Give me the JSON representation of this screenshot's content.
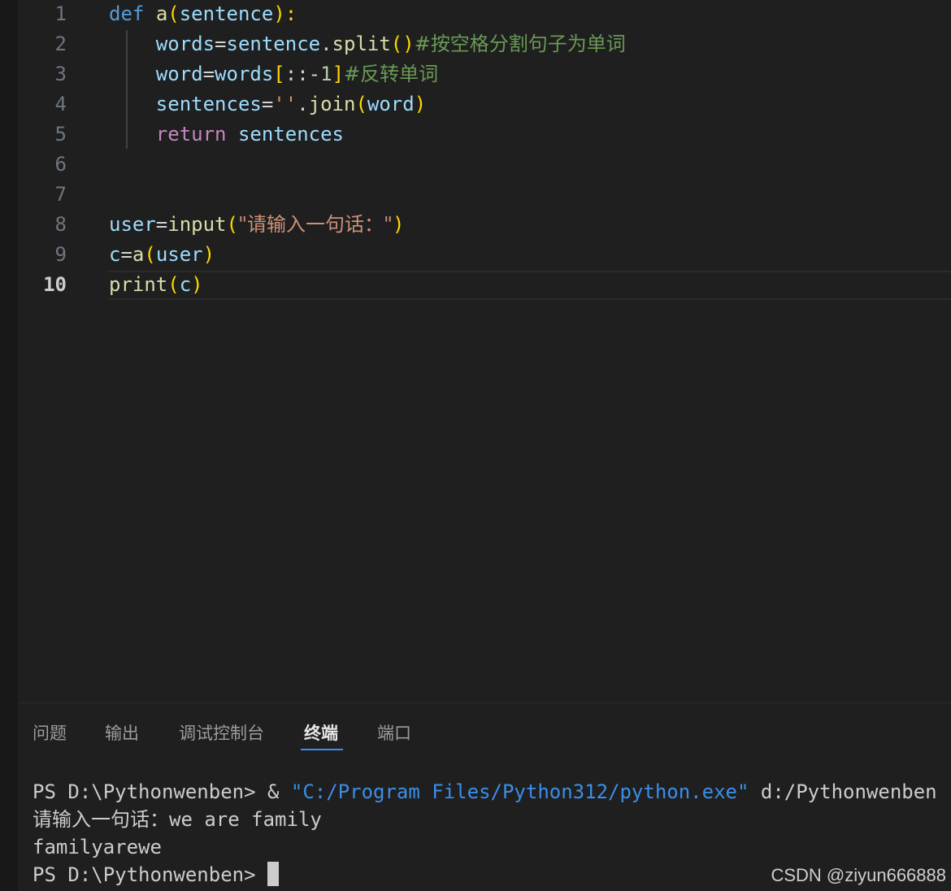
{
  "editor": {
    "active_line": "10",
    "lines": [
      {
        "num": "1",
        "parts": [
          {
            "t": "def",
            "c": "kw-def"
          },
          {
            "t": " ",
            "c": "op"
          },
          {
            "t": "a",
            "c": "fn"
          },
          {
            "t": "(",
            "c": "p1"
          },
          {
            "t": "sentence",
            "c": "var"
          },
          {
            "t": "):",
            "c": "p1"
          }
        ]
      },
      {
        "num": "2",
        "parts": [
          {
            "t": "    words",
            "c": "var"
          },
          {
            "t": "=",
            "c": "op"
          },
          {
            "t": "sentence",
            "c": "var"
          },
          {
            "t": ".",
            "c": "op"
          },
          {
            "t": "split",
            "c": "fn"
          },
          {
            "t": "()",
            "c": "p1"
          },
          {
            "t": "#按空格分割句子为单词",
            "c": "cmt"
          }
        ]
      },
      {
        "num": "3",
        "parts": [
          {
            "t": "    word",
            "c": "var"
          },
          {
            "t": "=",
            "c": "op"
          },
          {
            "t": "words",
            "c": "var"
          },
          {
            "t": "[",
            "c": "p1"
          },
          {
            "t": "::-",
            "c": "op"
          },
          {
            "t": "1",
            "c": "num"
          },
          {
            "t": "]",
            "c": "p1"
          },
          {
            "t": "#反转单词",
            "c": "cmt"
          }
        ]
      },
      {
        "num": "4",
        "parts": [
          {
            "t": "    sentences",
            "c": "var"
          },
          {
            "t": "=",
            "c": "op"
          },
          {
            "t": "''",
            "c": "str"
          },
          {
            "t": ".",
            "c": "op"
          },
          {
            "t": "join",
            "c": "fn"
          },
          {
            "t": "(",
            "c": "p1"
          },
          {
            "t": "word",
            "c": "var"
          },
          {
            "t": ")",
            "c": "p1"
          }
        ]
      },
      {
        "num": "5",
        "parts": [
          {
            "t": "    return",
            "c": "kw-ret"
          },
          {
            "t": " ",
            "c": "op"
          },
          {
            "t": "sentences",
            "c": "var"
          }
        ]
      },
      {
        "num": "6",
        "parts": []
      },
      {
        "num": "7",
        "parts": []
      },
      {
        "num": "8",
        "parts": [
          {
            "t": "user",
            "c": "var"
          },
          {
            "t": "=",
            "c": "op"
          },
          {
            "t": "input",
            "c": "fn"
          },
          {
            "t": "(",
            "c": "p1"
          },
          {
            "t": "\"请输入一句话：\"",
            "c": "str"
          },
          {
            "t": ")",
            "c": "p1"
          }
        ]
      },
      {
        "num": "9",
        "parts": [
          {
            "t": "c",
            "c": "var"
          },
          {
            "t": "=",
            "c": "op"
          },
          {
            "t": "a",
            "c": "fn"
          },
          {
            "t": "(",
            "c": "p1"
          },
          {
            "t": "user",
            "c": "var"
          },
          {
            "t": ")",
            "c": "p1"
          }
        ]
      },
      {
        "num": "10",
        "parts": [
          {
            "t": "print",
            "c": "fn"
          },
          {
            "t": "(",
            "c": "p1"
          },
          {
            "t": "c",
            "c": "var"
          },
          {
            "t": ")",
            "c": "p1"
          }
        ]
      }
    ]
  },
  "panel": {
    "tabs": [
      {
        "label": "问题",
        "active": false
      },
      {
        "label": "输出",
        "active": false
      },
      {
        "label": "调试控制台",
        "active": false
      },
      {
        "label": "终端",
        "active": true
      },
      {
        "label": "端口",
        "active": false
      }
    ]
  },
  "terminal": {
    "cmd_prompt": "PS D:\\Pythonwenben> & ",
    "cmd_exe": "\"C:/Program Files/Python312/python.exe\"",
    "cmd_arg": " d:/Pythonwenben",
    "input_line": "请输入一句话：we are family",
    "output_line": "familyarewe",
    "final_prompt": "PS D:\\Pythonwenben> "
  },
  "watermark": "CSDN @ziyun666888",
  "colors": {
    "background": "#1f1f1f",
    "keyword_def": "#569cd6",
    "keyword_return": "#c586c0",
    "function": "#dcdcaa",
    "variable": "#9cdcfe",
    "string": "#ce9178",
    "comment": "#6a9955",
    "bracket": "#ffd700",
    "terminal_string": "#3b8eea"
  }
}
